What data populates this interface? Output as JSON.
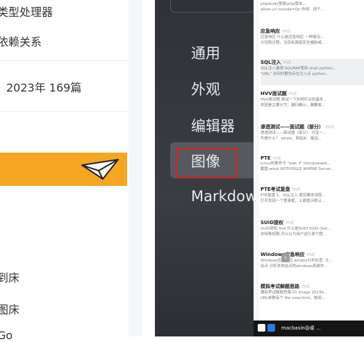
{
  "left_panel": {
    "line1": "类型处理器",
    "line2": "依赖关系",
    "stats": "2023年  169篇",
    "line4": "到床",
    "line5": "图床",
    "line6": "Go"
  },
  "menu": {
    "items": [
      "通用",
      "外观",
      "编辑器",
      "图像",
      "Markdown"
    ],
    "selected": "图像"
  },
  "files": [
    {
      "title": "",
      "body": [
        "phpstudy里面(php版本...",
        "allow url include=On 作用：用于..."
      ]
    },
    {
      "title": "应急响应",
      "body": [
        "应急响应 什么是应急响应 一种情况...",
        "计划和过程。当目标面临安全威胁或..."
      ]
    },
    {
      "title": "SQL注入",
      "body": [
        "SQL注入漏洞 SQLMAP使用 shell python...",
        "\"URL\" 访问时要先存在注入点 python..."
      ]
    },
    {
      "title": "HVV面试题",
      "body": [
        "HVV面试题 面试一下外网打点的基本...",
        "本因是主要分为：漏扫确认、漏要收..."
      ]
    },
    {
      "title": "渗透测试——面试题（部分）",
      "body": [
        "渗透测试——面试题（部分） 分享一...",
        "先做什么？ whois、网站IP、备站..."
      ]
    },
    {
      "title": "PTE",
      "body": [
        "Linux判断命令 \"awk -F '/etc/passwd...",
        "截图 wsuk ROTOOGLE WHERE Server..."
      ]
    },
    {
      "title": "PTE考试复盘",
      "body": [
        "PTE复盘 1、SQL注入 题目要求读取...",
        "打开发现一个登录框，上面提示默认..."
      ]
    },
    {
      "title": "SUID提权",
      "body": [
        "SUID提权 find 什么是SUID SUID (Set...",
        "并特殊权限,可以以为用户运行某个程..."
      ]
    },
    {
      "title": "Windows应急响应",
      "body": [
        "Windows应急响应 windos分析检查: 文...",
        "站点 分析本地站点的windows系统中..."
      ]
    },
    {
      "title": "模拟考试解题思路",
      "body": [
        "模拟考试解题思路 01 image 20230...",
        "URL参数有个 file view.html，被调..."
      ]
    }
  ],
  "md_tag": "md",
  "taskbar": {
    "text": "macbasin@桌 ..."
  },
  "colors": {
    "accent": "#f5a623",
    "highlight": "#e02020",
    "sidebar": "#33363b"
  }
}
